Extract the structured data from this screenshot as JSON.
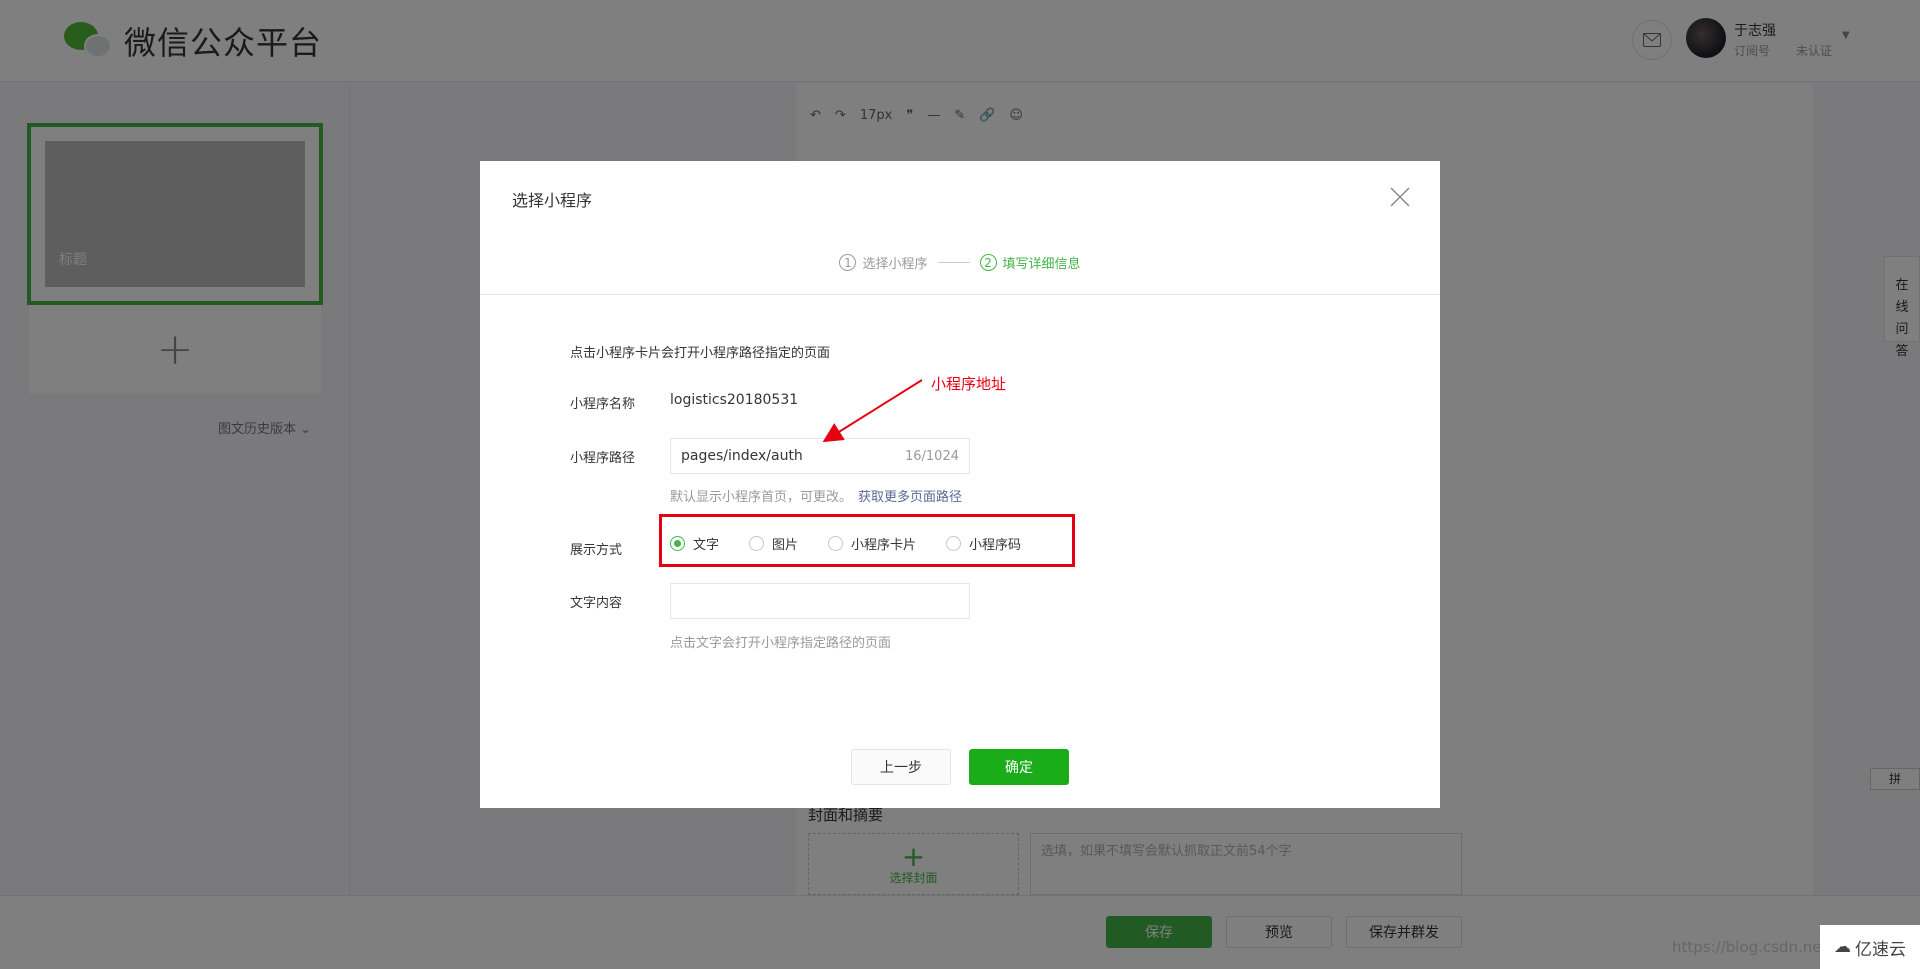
{
  "header": {
    "logo_text": "微信公众平台",
    "user_name": "于志强",
    "account_type": "订阅号",
    "verify_status": "未认证"
  },
  "left_panel": {
    "article_title_placeholder": "标题",
    "history_link": "图文历史版本"
  },
  "editor": {
    "font_size": "17px",
    "cover_heading": "封面和摘要",
    "cover_button_label": "选择封面",
    "summary_placeholder": "选填，如果不填写会默认抓取正文前54个字"
  },
  "bottom_bar": {
    "save_label": "保存",
    "preview_label": "预览",
    "save_send_label": "保存并群发"
  },
  "side": {
    "online_qa": "在线问答",
    "ime_label": "拼"
  },
  "watermark": "https://blog.csdn.net/y",
  "brand_badge": "亿速云",
  "dialog": {
    "title": "选择小程序",
    "steps": [
      {
        "num": "1",
        "label": "选择小程序"
      },
      {
        "num": "2",
        "label": "填写详细信息"
      }
    ],
    "tip": "点击小程序卡片会打开小程序路径指定的页面",
    "name_label": "小程序名称",
    "name_value": "logistics20180531",
    "path_label": "小程序路径",
    "path_value": "pages/index/auth",
    "path_count": "16/1024",
    "path_help": "默认显示小程序首页，可更改。",
    "path_help_link": "获取更多页面路径",
    "display_label": "展示方式",
    "display_options": [
      {
        "label": "文字",
        "checked": true
      },
      {
        "label": "图片",
        "checked": false
      },
      {
        "label": "小程序卡片",
        "checked": false
      },
      {
        "label": "小程序码",
        "checked": false
      }
    ],
    "text_label": "文字内容",
    "text_value": "",
    "text_help": "点击文字会打开小程序指定路径的页面",
    "prev_button": "上一步",
    "ok_button": "确定"
  },
  "annotation": {
    "label": "小程序地址",
    "color": "#e60012"
  },
  "colors": {
    "accent": "#44b549",
    "confirm_green": "#1aad19",
    "link": "#576b95"
  }
}
